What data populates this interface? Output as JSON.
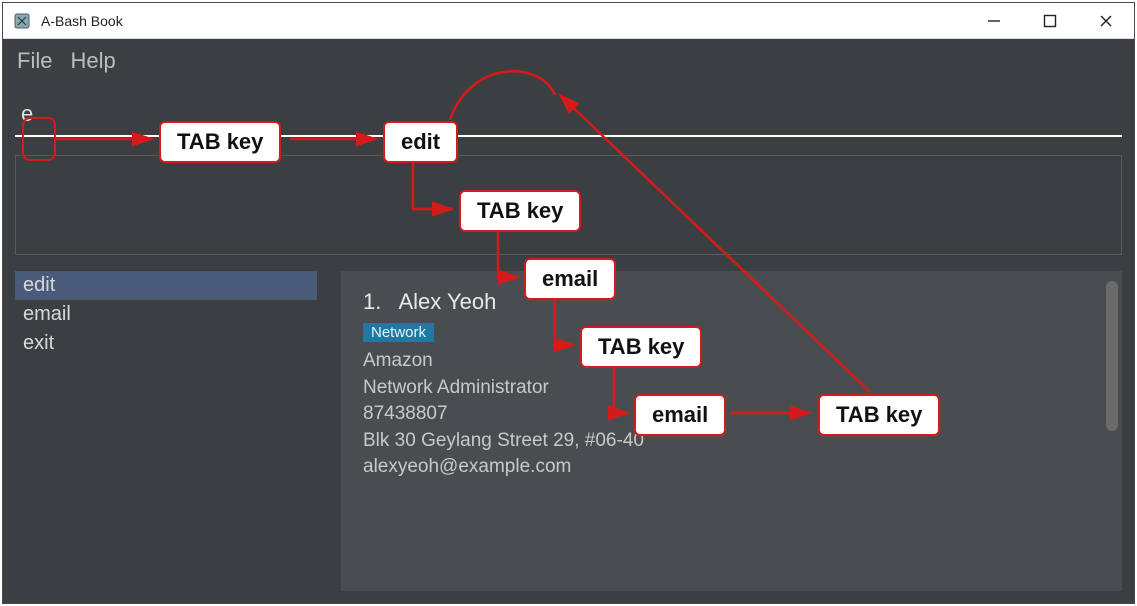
{
  "window": {
    "title": "A-Bash Book"
  },
  "menubar": {
    "file": "File",
    "help": "Help"
  },
  "command": {
    "value": "e"
  },
  "suggestions": {
    "items": [
      {
        "label": "edit",
        "selected": true
      },
      {
        "label": "email",
        "selected": false
      },
      {
        "label": "exit",
        "selected": false
      }
    ]
  },
  "detail": {
    "index": "1.",
    "name": "Alex Yeoh",
    "tag": "Network",
    "company": "Amazon",
    "role": "Network Administrator",
    "phone": "87438807",
    "address": "Blk 30 Geylang Street 29, #06-40",
    "email": "alexyeoh@example.com"
  },
  "annotations": {
    "tab1": "TAB key",
    "edit": "edit",
    "tab2": "TAB key",
    "email1": "email",
    "tab3": "TAB key",
    "email2": "email",
    "tab4": "TAB key"
  }
}
